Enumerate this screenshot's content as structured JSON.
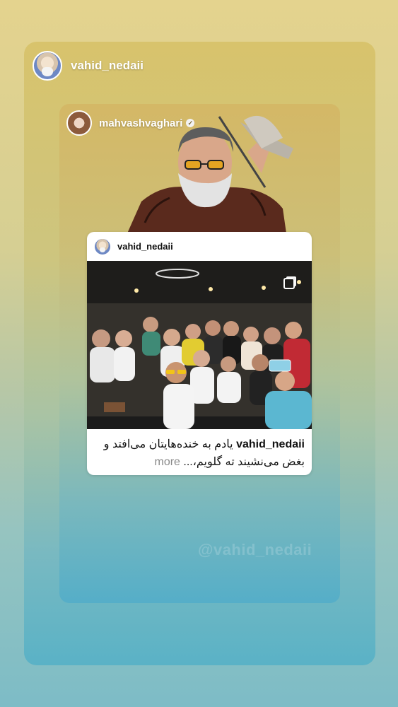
{
  "story": {
    "username": "vahid_nedaii"
  },
  "reshare": {
    "username": "mahvashvaghari",
    "verified": true,
    "watermark": "@vahid_nedaii"
  },
  "post": {
    "username": "vahid_nedaii",
    "caption_user": "vahid_nedaii",
    "caption_text": "یادم به خنده‌هایتان می‌افتد و بغض می‌نشیند ته گلویم،...",
    "more_label": "more"
  },
  "icons": {
    "verified": "verified-badge-icon",
    "carousel": "multiple-photos-icon"
  },
  "colors": {
    "accent_gold": "#d6c06a",
    "accent_teal": "#5ab2c6"
  }
}
